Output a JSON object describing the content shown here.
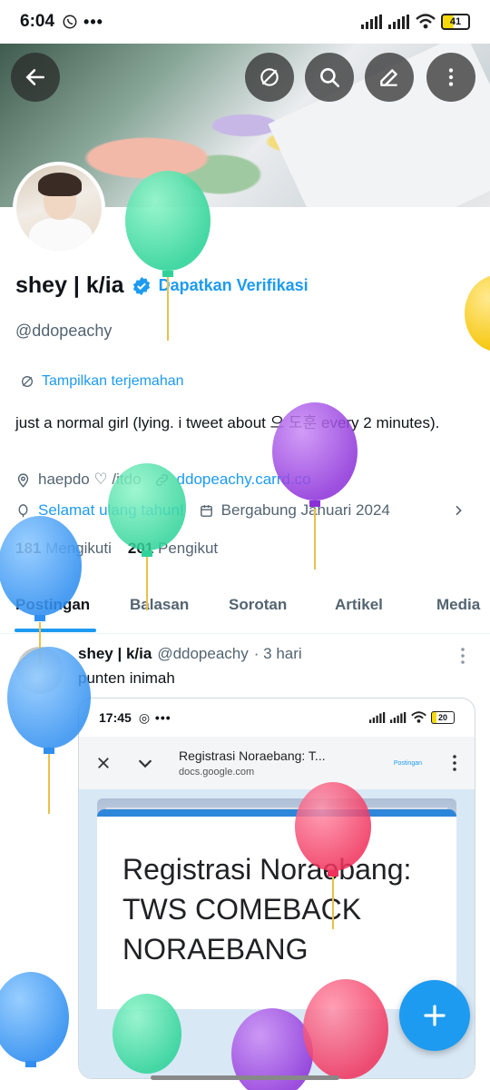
{
  "status_bar": {
    "time": "6:04",
    "battery": "41"
  },
  "header": {
    "back_icon": "arrow-left-icon",
    "translate_icon": "translate-icon",
    "search_icon": "search-icon",
    "edit_icon": "pencil-icon",
    "more_icon": "more-vertical-icon"
  },
  "profile": {
    "name": "shey | k/ia",
    "verify_link": "Dapatkan Verifikasi",
    "handle": "@ddopeachy",
    "translate_label": "Tampilkan terjemahan",
    "bio": "just a normal girl (lying. i tweet about 으 도훈 every 2 minutes).",
    "location": "haepdo ♡ /itdo",
    "website": "ddopeachy.carrd.co",
    "birthday": "Selamat ulang tahun!",
    "joined": "Bergabung Januari 2024",
    "following_count": "181",
    "following_label": "Mengikuti",
    "followers_count": "201",
    "followers_label": "Pengikut"
  },
  "tabs": [
    "Postingan",
    "Balasan",
    "Sorotan",
    "Artikel",
    "Media"
  ],
  "post": {
    "author": "shey | k/ia",
    "handle": "@ddopeachy",
    "time": "· 3 hari",
    "text": "punten inimah",
    "screenshot": {
      "time": "17:45",
      "battery": "20",
      "page_title": "Registrasi Noraebang: T...",
      "url": "docs.google.com",
      "mini_label": "Postingan",
      "form_title": "Registrasi Noraebang: TWS COMEBACK NORAEBANG"
    }
  },
  "colors": {
    "accent": "#1d9bf0",
    "text": "#0f1419",
    "muted": "#536471"
  }
}
